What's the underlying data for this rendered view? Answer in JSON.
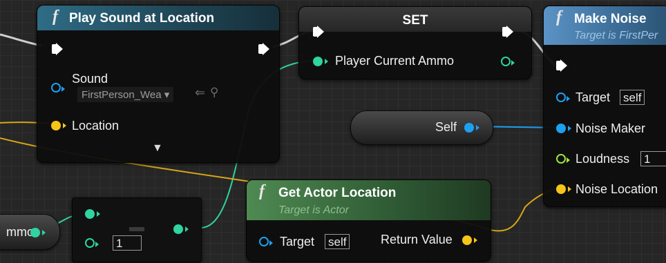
{
  "nodes": {
    "play_sound": {
      "title": "Play Sound at Location",
      "sound_label": "Sound",
      "sound_value": "FirstPerson_Wea",
      "location_label": "Location"
    },
    "set": {
      "title": "SET",
      "var_label": "Player Current Ammo"
    },
    "make_noise": {
      "title": "Make Noise",
      "subtitle": "Target is FirstPer",
      "target_label": "Target",
      "target_value": "self",
      "noise_maker_label": "Noise Maker",
      "loudness_label": "Loudness",
      "loudness_value": "1",
      "noise_location_label": "Noise Location"
    },
    "self_ref": {
      "label": "Self"
    },
    "get_actor_location": {
      "title": "Get Actor Location",
      "subtitle": "Target is Actor",
      "target_label": "Target",
      "target_value": "self",
      "return_label": "Return Value"
    },
    "ammo_var": {
      "label": "mmo"
    },
    "subtract": {
      "value": "1"
    }
  },
  "colors": {
    "background": "#262626",
    "exec_pin": "#ffffff",
    "object_pin": "#1ea0f0",
    "vector_pin": "#f5c518",
    "int_pin": "#2fd4a0",
    "float_pin": "#9ee542"
  },
  "icons": [
    "function-icon",
    "exec-pin",
    "data-pin",
    "dropdown-arrow-icon",
    "browse-icon",
    "search-icon",
    "expand-arrow-icon"
  ]
}
